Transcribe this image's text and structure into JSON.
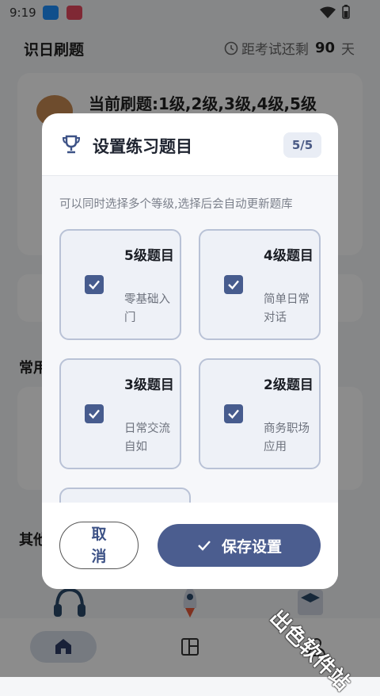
{
  "status": {
    "time": "9:19"
  },
  "app": {
    "title": "识日刷题",
    "countdown_prefix": "距考试还剩",
    "countdown_days": "90",
    "countdown_unit": "天",
    "current_levels": "当前刷题:1级,2级,3级,4级,5级",
    "section_common": "常用",
    "section_other": "其他"
  },
  "dialog": {
    "title": "设置练习题目",
    "count_badge": "5/5",
    "hint": "可以同时选择多个等级,选择后会自动更新题库",
    "options": [
      {
        "title": "5级题目",
        "desc": "零基础入门",
        "checked": true
      },
      {
        "title": "4级题目",
        "desc": "简单日常对话",
        "checked": true
      },
      {
        "title": "3级题目",
        "desc": "日常交流自如",
        "checked": true
      },
      {
        "title": "2级题目",
        "desc": "商务职场应用",
        "checked": true
      }
    ],
    "cancel_label": "取消",
    "save_label": "保存设置"
  },
  "watermark": "出色软件站",
  "colors": {
    "accent": "#4b5d8f",
    "check": "#475c8e",
    "badge_bg": "#e9edf5"
  },
  "icons": [
    "download-icon",
    "app-icon",
    "wifi-icon",
    "battery-icon",
    "clock-icon",
    "trophy-icon",
    "check-icon",
    "home-icon",
    "layout-icon",
    "person-icon"
  ]
}
